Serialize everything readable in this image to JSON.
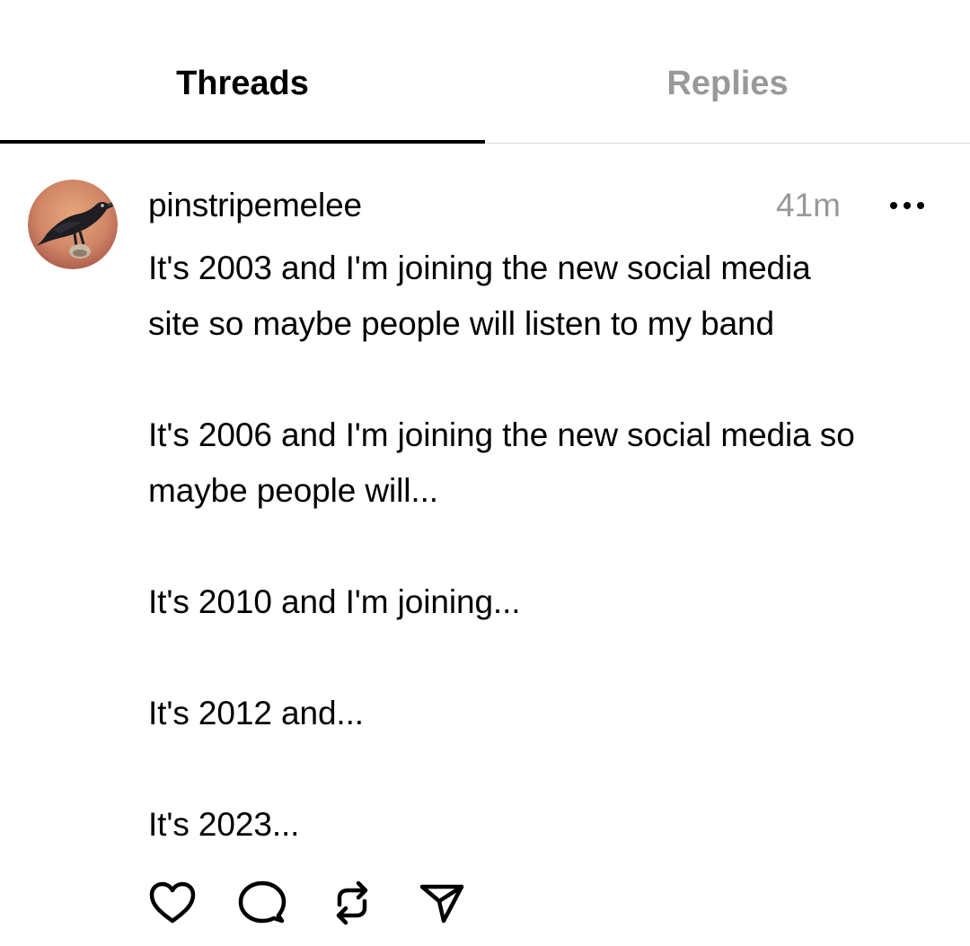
{
  "tabs": {
    "threads": "Threads",
    "replies": "Replies",
    "active": "threads"
  },
  "post": {
    "username": "pinstripemelee",
    "timestamp": "41m",
    "text": "It's 2003 and I'm joining the new social media\nsite so maybe people will listen to my band\n\nIt's 2006 and I'm joining the new social media so\nmaybe people will...\n\nIt's 2010 and I'm joining...\n\nIt's 2012 and...\n\nIt's 2023...",
    "avatar": "raven-avatar",
    "menu_icon": "more-options-icon",
    "actions": [
      "heart-icon",
      "comment-icon",
      "repost-icon",
      "share-icon"
    ]
  },
  "colors": {
    "active_tab": "#000000",
    "inactive_tab": "#999999",
    "timestamp": "#999999",
    "divider": "#dcdcdc",
    "background": "#ffffff"
  }
}
